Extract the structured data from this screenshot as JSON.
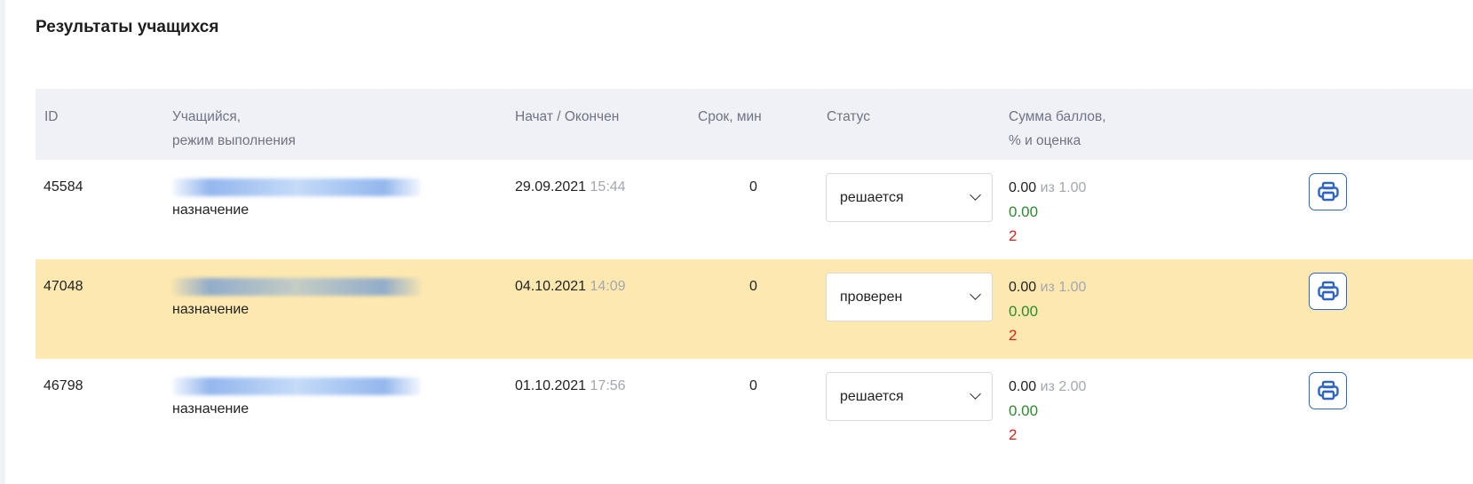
{
  "page": {
    "title": "Результаты учащихся"
  },
  "table": {
    "headers": {
      "id": "ID",
      "student_line1": "Учащийся,",
      "student_line2": "режим выполнения",
      "started": "Начат / Окончен",
      "term": "Срок, мин",
      "status": "Статус",
      "score_line1": "Сумма баллов,",
      "score_line2": "% и оценка"
    },
    "rows": [
      {
        "id": "45584",
        "student": "Андрей Владимирович Флегантов",
        "mode": "назначение",
        "date": "29.09.2021",
        "time": "15:44",
        "term": "0",
        "status": "решается",
        "points": "0.00",
        "of": "из 1.00",
        "percent": "0.00",
        "grade": "2",
        "highlighted": false
      },
      {
        "id": "47048",
        "student": "Солимхан Эльдарович Аббасов",
        "mode": "назначение",
        "date": "04.10.2021",
        "time": "14:09",
        "term": "0",
        "status": "проверен",
        "points": "0.00",
        "of": "из 1.00",
        "percent": "0.00",
        "grade": "2",
        "highlighted": true
      },
      {
        "id": "46798",
        "student": "Татьяна Федоровна Фомина",
        "mode": "назначение",
        "date": "01.10.2021",
        "time": "17:56",
        "term": "0",
        "status": "решается",
        "points": "0.00",
        "of": "из 2.00",
        "percent": "0.00",
        "grade": "2",
        "highlighted": false
      }
    ]
  },
  "icons": {
    "print": "printer-icon",
    "chevron": "chevron-down-icon"
  },
  "colors": {
    "accent": "#2e64c9",
    "link": "#3a7be0",
    "highlight_row": "#fde9b0",
    "percent": "#2f8a2f",
    "grade": "#e02020",
    "muted": "#a4a7b0",
    "header_bg": "#f0f1f6"
  }
}
